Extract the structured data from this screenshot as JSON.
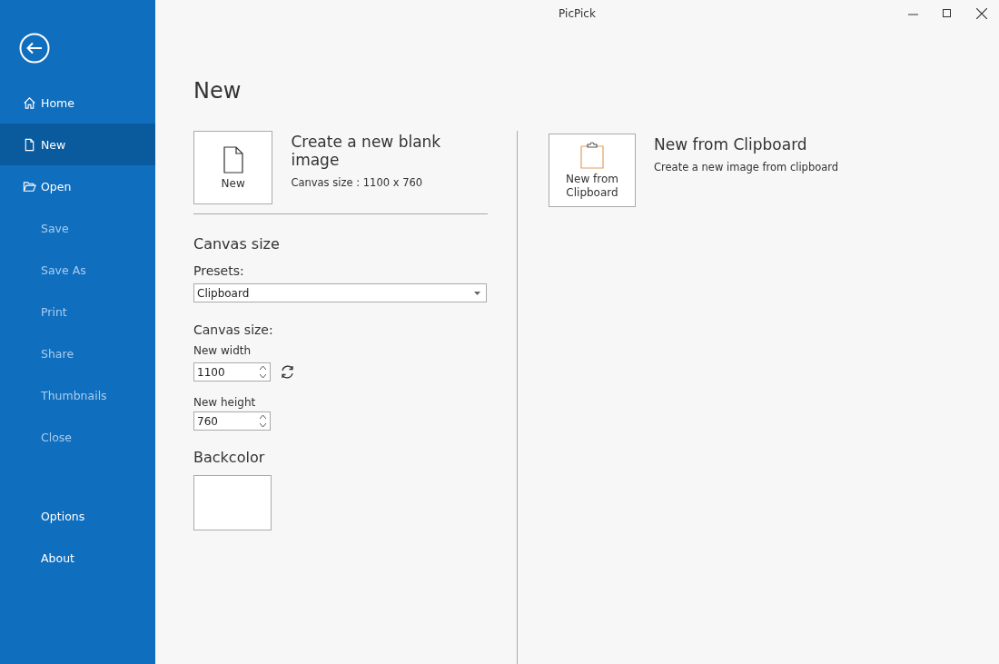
{
  "window": {
    "title": "PicPick"
  },
  "sidebar": {
    "items": [
      {
        "label": "Home",
        "selected": false,
        "disabled": false
      },
      {
        "label": "New",
        "selected": true,
        "disabled": false
      },
      {
        "label": "Open",
        "selected": false,
        "disabled": false
      },
      {
        "label": "Save",
        "selected": false,
        "disabled": true
      },
      {
        "label": "Save As",
        "selected": false,
        "disabled": true
      },
      {
        "label": "Print",
        "selected": false,
        "disabled": true
      },
      {
        "label": "Share",
        "selected": false,
        "disabled": true
      },
      {
        "label": "Thumbnails",
        "selected": false,
        "disabled": true
      },
      {
        "label": "Close",
        "selected": false,
        "disabled": true
      }
    ],
    "bottom_items": [
      {
        "label": "Options",
        "selected": false,
        "disabled": false
      },
      {
        "label": "About",
        "selected": false,
        "disabled": false
      }
    ]
  },
  "page_title": "New",
  "blank": {
    "tile_label": "New",
    "title": "Create a new blank image",
    "subtitle": "Canvas size : 1100 x 760"
  },
  "canvas_size": {
    "heading": "Canvas size",
    "presets_label": "Presets:",
    "preset_value": "Clipboard",
    "size_label": "Canvas size:",
    "width_label": "New width",
    "width_value": "1100",
    "height_label": "New height",
    "height_value": "760"
  },
  "backcolor": {
    "heading": "Backcolor",
    "color": "#ffffff"
  },
  "clipboard": {
    "tile_label": "New from Clipboard",
    "title": "New from Clipboard",
    "subtitle": "Create a new image from clipboard"
  }
}
